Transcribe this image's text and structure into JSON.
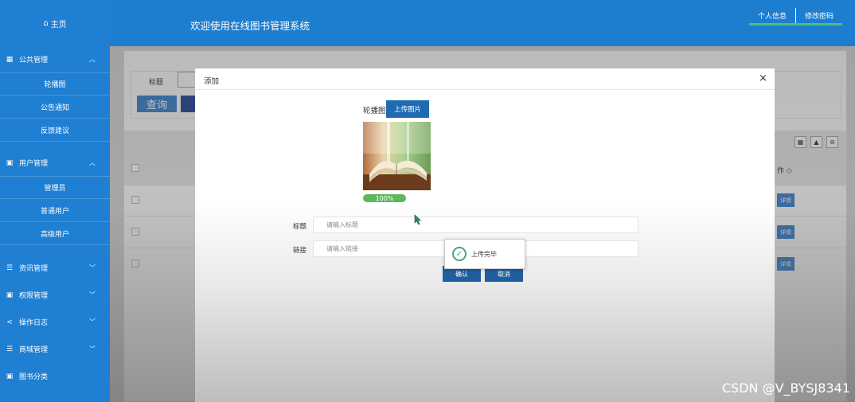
{
  "sidebar": {
    "home_label": "主页",
    "groups": [
      {
        "label": "公共管理",
        "items": [
          "轮播图",
          "公告通知",
          "反馈建议"
        ]
      },
      {
        "label": "用户管理",
        "items": [
          "管理员",
          "普通用户",
          "高级用户"
        ]
      },
      {
        "label": "资讯管理"
      },
      {
        "label": "权限管理"
      },
      {
        "label": "操作日志"
      },
      {
        "label": "商城管理"
      },
      {
        "label": "图书分类"
      }
    ]
  },
  "header": {
    "title": "欢迎使用在线图书管理系统",
    "profile_link": "个人信息",
    "password_link": "修改密码"
  },
  "main": {
    "search_label": "标题",
    "query_button": "查询",
    "op_header": "作 ◇",
    "detail_button": "详情"
  },
  "modal": {
    "title": "添加",
    "close": "×",
    "carousel_label": "轮播图",
    "upload_button": "上传图片",
    "progress_text": "100%",
    "progress_value": 1.0,
    "title_label": "标题",
    "title_placeholder": "请输入标题",
    "link_label": "链接",
    "link_placeholder": "请输入链接",
    "confirm_button": "确认",
    "cancel_button": "取消"
  },
  "toast": {
    "text": "上传完毕"
  },
  "watermark": "CSDN @V_BYSJ8341",
  "colors": {
    "sidebar": "#1f7fd2",
    "header": "#1d7dcf",
    "primary_button": "#1f6bb2",
    "success": "#5cb85c",
    "accent_underline": "#4cc07a"
  }
}
